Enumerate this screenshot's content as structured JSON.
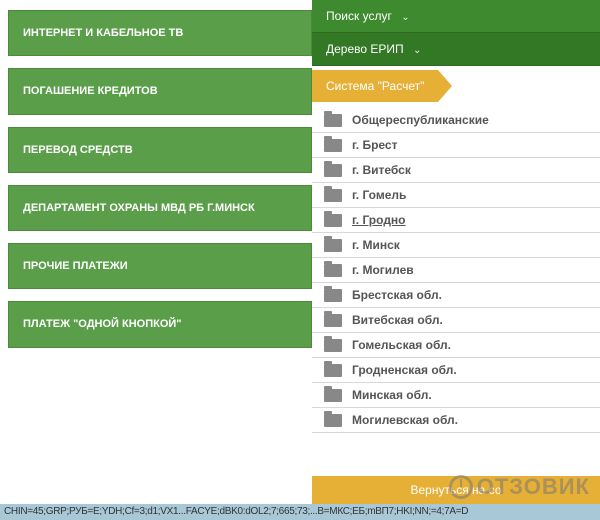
{
  "left_buttons": [
    "Интернет и кабельное ТВ",
    "Погашение кредитов",
    "Перевод средств",
    "Департамент охраны МВД РБ г.Минск",
    "Прочие платежи",
    "Платеж \"Одной кнопкой\""
  ],
  "right": {
    "search_label": "Поиск услуг",
    "tree_label": "Дерево ЕРИП",
    "system_label": "Система \"Расчет\"",
    "items": [
      {
        "label": "Общереспубликанские",
        "hover": false
      },
      {
        "label": "г. Брест",
        "hover": false
      },
      {
        "label": "г. Витебск",
        "hover": false
      },
      {
        "label": "г. Гомель",
        "hover": false
      },
      {
        "label": "г. Гродно",
        "hover": true
      },
      {
        "label": "г. Минск",
        "hover": false
      },
      {
        "label": "г. Могилев",
        "hover": false
      },
      {
        "label": "Брестская обл.",
        "hover": false
      },
      {
        "label": "Витебская обл.",
        "hover": false
      },
      {
        "label": "Гомельская обл.",
        "hover": false
      },
      {
        "label": "Гродненская обл.",
        "hover": false
      },
      {
        "label": "Минская обл.",
        "hover": false
      },
      {
        "label": "Могилевская обл.",
        "hover": false
      }
    ],
    "return_label": "Вернуться на со"
  },
  "watermark": "ОТЗОВИК",
  "footer": "CHIN=45;GRP;РУБ=E;YDH;Cf=3;d1;VX1...FACYE;dBK0:dOL2;7;665;73;...B=МКС;EБ;mBП7;HKI;NN;=4;7A=D"
}
